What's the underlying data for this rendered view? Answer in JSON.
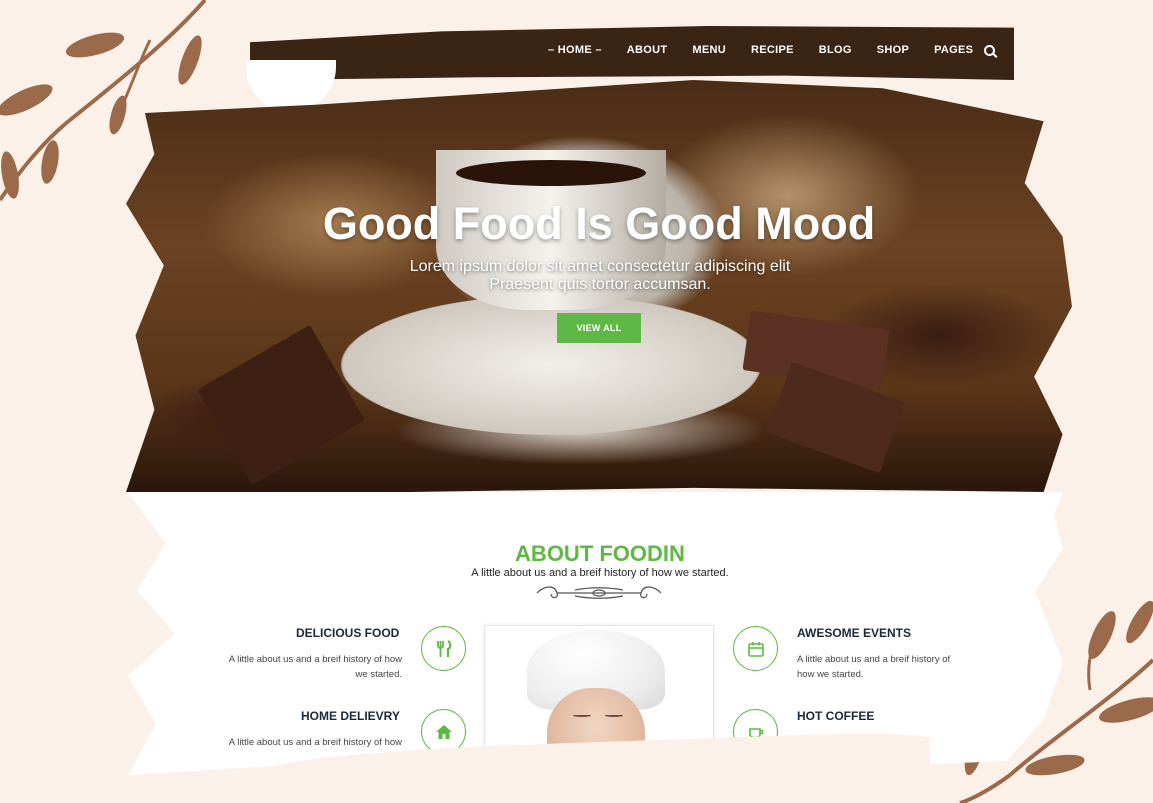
{
  "nav": {
    "items": [
      {
        "label": "HOME",
        "active": true
      },
      {
        "label": "ABOUT"
      },
      {
        "label": "MENU"
      },
      {
        "label": "RECIPE"
      },
      {
        "label": "BLOG"
      },
      {
        "label": "SHOP"
      },
      {
        "label": "PAGES"
      }
    ],
    "search_icon": "search-icon"
  },
  "hero": {
    "title": "Good Food Is Good Mood",
    "subtitle": "Lorem ipsum dolor sit amet consectetur adipiscing elit Praesent quis tortor accumsan.",
    "button_label": "VIEW ALL"
  },
  "about": {
    "title": "ABOUT FOODIN",
    "subtitle": "A little about us and a breif history of how we started.",
    "features": [
      {
        "title": "DELICIOUS FOOD",
        "text": "A little about us and a breif history of how we started.",
        "icon": "fork-knife-icon"
      },
      {
        "title": "AWESOME EVENTS",
        "text": "A little about us and a breif history of how we started.",
        "icon": "calendar-icon"
      },
      {
        "title": "HOME DELIEVRY",
        "text": "A little about us and a breif history of how we started.",
        "icon": "home-icon"
      },
      {
        "title": "HOT COFFEE",
        "text": "",
        "icon": "coffee-icon"
      }
    ]
  },
  "colors": {
    "accent": "#5fb845",
    "nav_bg": "#3a2414",
    "page_bg": "#fcf1e8",
    "heading": "#1b2838"
  }
}
